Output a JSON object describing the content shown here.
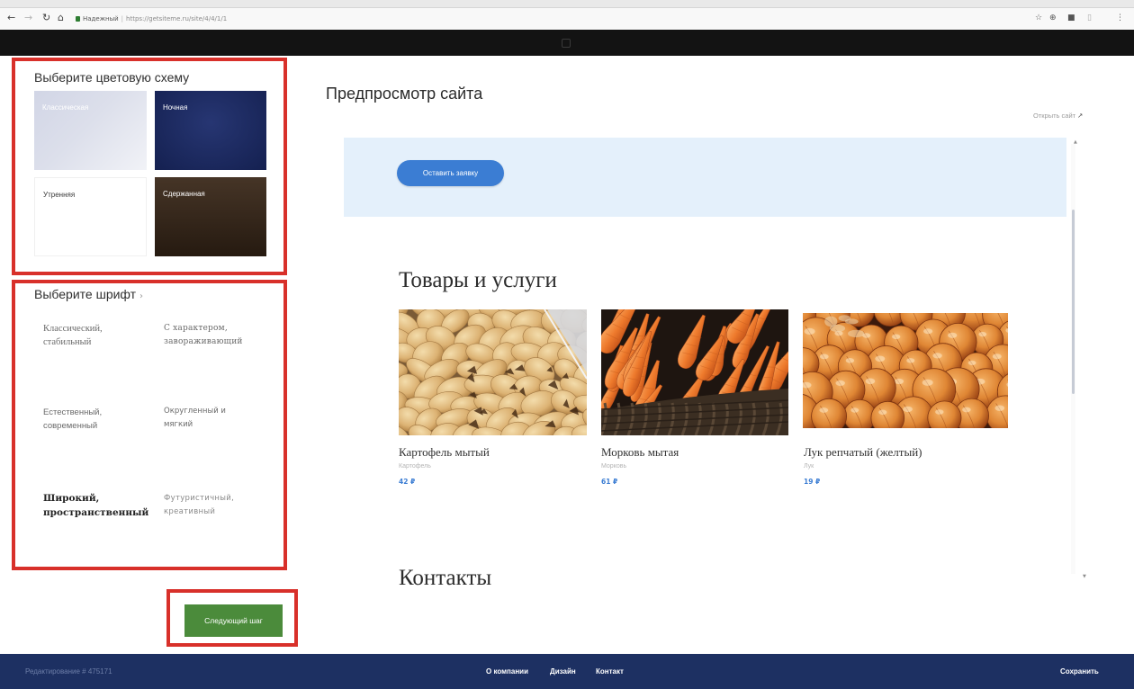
{
  "browser": {
    "secure_label": "Надежный",
    "url": "https://getsiteme.ru/site/4/4/1/1",
    "icons": [
      "back-icon",
      "forward-icon",
      "reload-icon",
      "home-icon",
      "lock-icon",
      "star-icon",
      "zoom-icon",
      "extension-icon",
      "cast-icon",
      "menu-icon"
    ]
  },
  "colors": {
    "highlight_frame": "#d8302a",
    "accent_blue": "#3b7dd3",
    "next_green": "#4b8b3b",
    "footer_navy": "#1d3062",
    "hero_bg": "#e4f0fb"
  },
  "sidebar": {
    "color_scheme": {
      "title": "Выберите цветовую схему",
      "options": [
        {
          "label": "Классическая",
          "color": "#dcdfeb",
          "text_color": "#ffffff"
        },
        {
          "label": "Ночная",
          "color": "#1b2b6b",
          "text_color": "#ffffff"
        },
        {
          "label": "Утренняя",
          "color": "#ffffff",
          "text_color": "#3a3a3a"
        },
        {
          "label": "Сдержанная",
          "color": "#3a2819",
          "text_color": "#ffffff"
        }
      ]
    },
    "font": {
      "title": "Выберите шрифт",
      "chevron_icon": "chevron-right-icon",
      "options": [
        {
          "label": "Классический, стабильный"
        },
        {
          "label": "С характером, завораживающий"
        },
        {
          "label": "Естественный, современный"
        },
        {
          "label": "Округленный и мягкий"
        },
        {
          "label": "Широкий, пространственный",
          "selected": true
        },
        {
          "label": "Футуристичный, креативный"
        }
      ]
    },
    "next_button": "Следующий шаг"
  },
  "preview": {
    "title": "Предпросмотр сайта",
    "open_link": "Открыть сайт",
    "open_link_icon": "↗",
    "hero_button": "Оставить заявку",
    "products_title": "Товары и услуги",
    "products": [
      {
        "name": "Картофель мытый",
        "category": "Картофель",
        "price": "42 ₽",
        "image": "potatoes"
      },
      {
        "name": "Морковь мытая",
        "category": "Морковь",
        "price": "61 ₽",
        "image": "carrots"
      },
      {
        "name": "Лук репчатый (желтый)",
        "category": "Лук",
        "price": "19 ₽",
        "image": "onions"
      }
    ],
    "contacts_title": "Контакты"
  },
  "footer": {
    "status": "Редактирование # 475171",
    "links": [
      "О компании",
      "Дизайн",
      "Контакт"
    ],
    "save": "Сохранить"
  }
}
